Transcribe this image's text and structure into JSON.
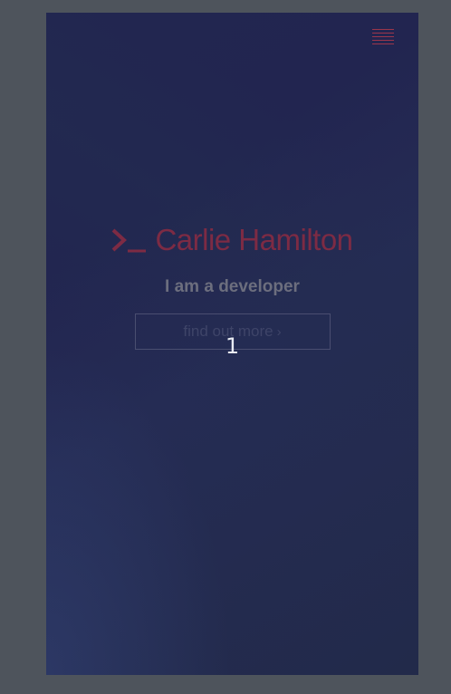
{
  "hero": {
    "name": "Carlie Hamilton",
    "tagline": "I am a developer",
    "cta_label": "find out more",
    "cta_chevron": "›"
  },
  "overlay": {
    "slide_number": "1"
  },
  "icons": {
    "menu": "hamburger-menu-icon",
    "prompt": "terminal-prompt-icon"
  },
  "colors": {
    "accent": "#7d2b44",
    "background": "#222650"
  }
}
